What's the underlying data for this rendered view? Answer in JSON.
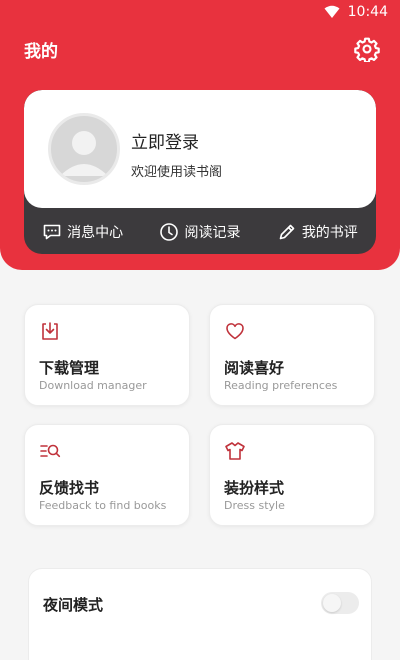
{
  "status_bar": {
    "time": "10:44",
    "wifi_icon": "wifi-icon"
  },
  "header": {
    "title": "我的",
    "settings_icon": "gear-icon",
    "accent_color": "#e8323e"
  },
  "profile": {
    "login_label": "立即登录",
    "welcome_text": "欢迎使用读书阁",
    "avatar_icon": "user-avatar-icon"
  },
  "quick_actions": [
    {
      "label": "消息中心",
      "icon": "message-icon"
    },
    {
      "label": "阅读记录",
      "icon": "clock-icon"
    },
    {
      "label": "我的书评",
      "icon": "pencil-icon"
    }
  ],
  "tiles": [
    {
      "title": "下载管理",
      "subtitle": "Download manager",
      "icon": "download-icon"
    },
    {
      "title": "阅读喜好",
      "subtitle": "Reading preferences",
      "icon": "heart-icon"
    },
    {
      "title": "反馈找书",
      "subtitle": "Feedback to find books",
      "icon": "search-list-icon"
    },
    {
      "title": "装扮样式",
      "subtitle": "Dress style",
      "icon": "shirt-icon"
    }
  ],
  "night_mode": {
    "label": "夜间模式",
    "enabled": false
  }
}
